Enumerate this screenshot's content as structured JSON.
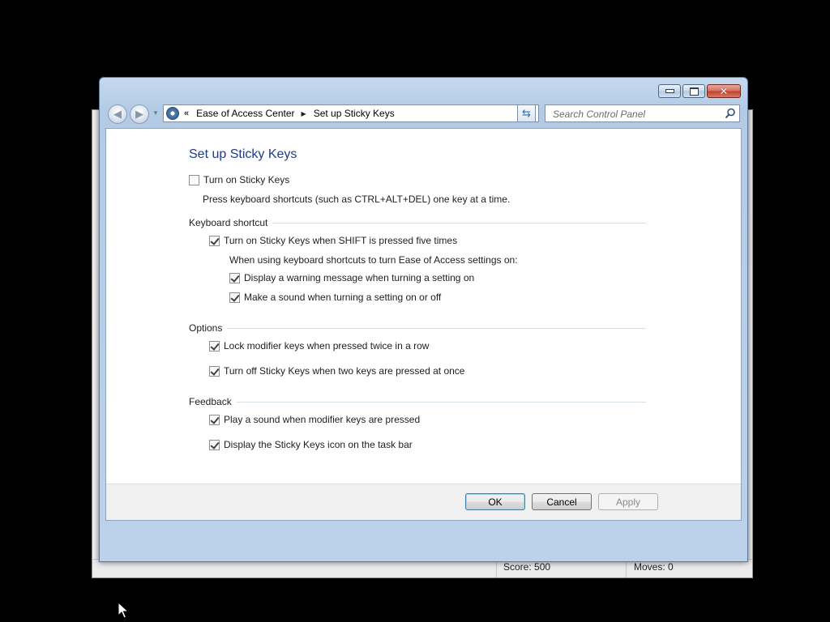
{
  "background_window": {
    "score_text": "Score: 500",
    "moves_text": "Moves:   0"
  },
  "window": {
    "caption_buttons": [
      "minimize",
      "maximize",
      "close"
    ],
    "address_bar": {
      "chevron": "«",
      "breadcrumbs": [
        "Ease of Access Center",
        "Set up Sticky Keys"
      ],
      "separator": "▶",
      "dropdown": "▼"
    },
    "search": {
      "placeholder": "Search Control Panel",
      "value": ""
    }
  },
  "page": {
    "title": "Set up Sticky Keys",
    "main_option": {
      "label": "Turn on Sticky Keys",
      "checked": false,
      "description": "Press keyboard shortcuts (such as CTRL+ALT+DEL) one key at a time."
    },
    "keyboard_shortcut": {
      "header": "Keyboard shortcut",
      "shift_option": {
        "label": "Turn on Sticky Keys when SHIFT is pressed five times",
        "checked": true
      },
      "subheading": "When using keyboard shortcuts to turn Ease of Access settings on:",
      "warning_option": {
        "label": "Display a warning message when turning a setting on",
        "checked": true
      },
      "sound_option": {
        "label": "Make a sound when turning a setting on or off",
        "checked": true
      }
    },
    "options": {
      "header": "Options",
      "lock_option": {
        "label": "Lock modifier keys when pressed twice in a row",
        "checked": true
      },
      "turnoff_option": {
        "label": "Turn off Sticky Keys when two keys are pressed at once",
        "checked": true
      }
    },
    "feedback": {
      "header": "Feedback",
      "play_sound_option": {
        "label": "Play a sound when modifier keys are pressed",
        "checked": true
      },
      "taskbar_icon_option": {
        "label": "Display the Sticky Keys icon on the task bar",
        "checked": true
      }
    }
  },
  "buttons": {
    "ok": "OK",
    "cancel": "Cancel",
    "apply": "Apply",
    "apply_enabled": false
  },
  "colors": {
    "title_blue": "#1f3c88",
    "window_frame": "#bcd2ea",
    "desktop": "#000000"
  }
}
